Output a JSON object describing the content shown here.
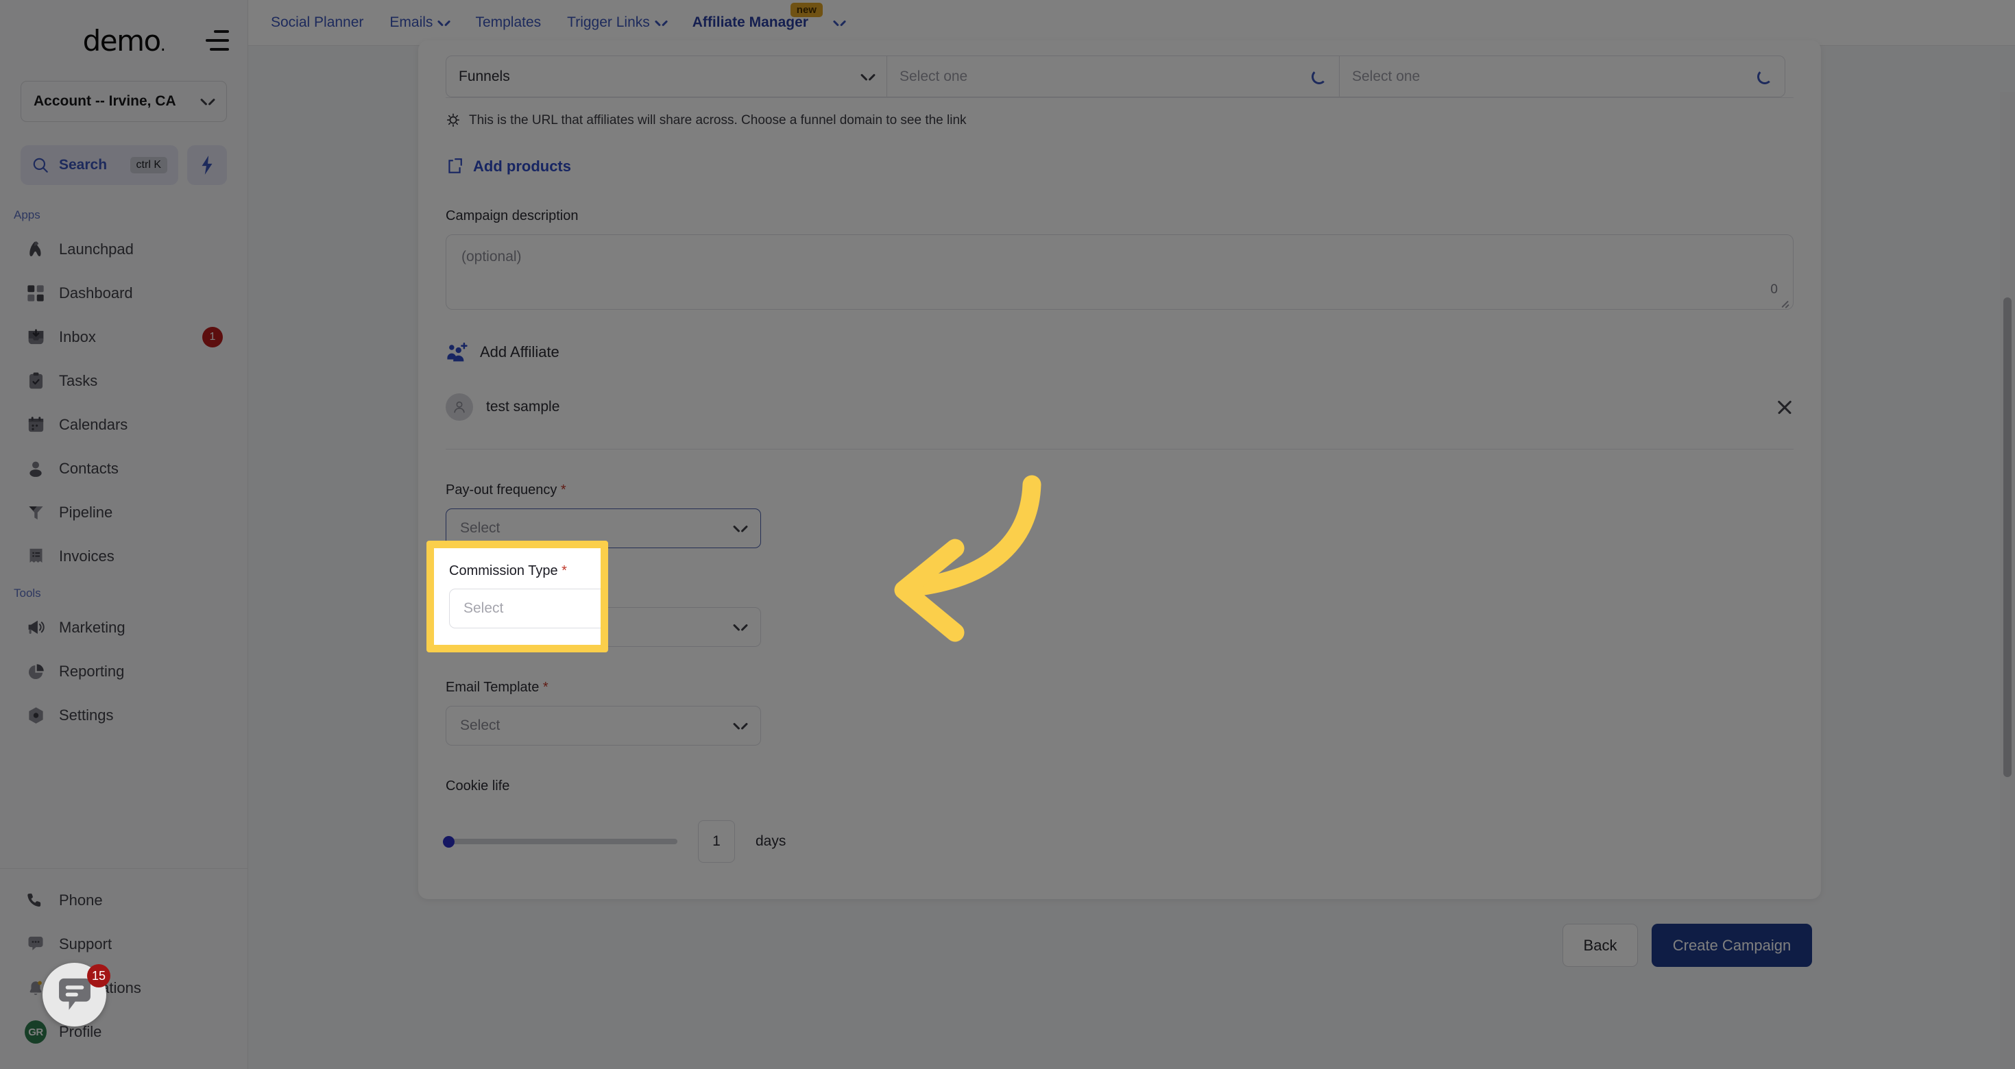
{
  "sidebar": {
    "brand": "demo",
    "account": {
      "label": "Account -- Irvine, CA"
    },
    "search": {
      "label": "Search",
      "shortcut": "ctrl K"
    },
    "groups": [
      {
        "title": "Apps",
        "items": [
          {
            "label": "Launchpad",
            "icon": "launchpad-icon",
            "badge": ""
          },
          {
            "label": "Dashboard",
            "icon": "dashboard-icon",
            "badge": ""
          },
          {
            "label": "Inbox",
            "icon": "inbox-icon",
            "badge": "1"
          },
          {
            "label": "Tasks",
            "icon": "tasks-icon",
            "badge": ""
          },
          {
            "label": "Calendars",
            "icon": "calendar-icon",
            "badge": ""
          },
          {
            "label": "Contacts",
            "icon": "contacts-icon",
            "badge": ""
          },
          {
            "label": "Pipeline",
            "icon": "pipeline-icon",
            "badge": ""
          },
          {
            "label": "Invoices",
            "icon": "invoices-icon",
            "badge": ""
          }
        ]
      },
      {
        "title": "Tools",
        "items": [
          {
            "label": "Marketing",
            "icon": "megaphone-icon",
            "badge": ""
          },
          {
            "label": "Reporting",
            "icon": "pie-chart-icon",
            "badge": ""
          },
          {
            "label": "Settings",
            "icon": "gear-icon",
            "badge": ""
          }
        ]
      }
    ],
    "bottom_items": [
      {
        "label": "Phone",
        "icon": "phone-icon",
        "badge": ""
      },
      {
        "label": "Support",
        "icon": "chat-bubble-icon",
        "badge": ""
      },
      {
        "label": "Notifications",
        "icon": "bell-icon",
        "badge": ""
      },
      {
        "label": "Profile",
        "icon": "avatar-icon",
        "badge": "",
        "avatar_initials": "GR"
      }
    ]
  },
  "topnav": {
    "tabs": [
      {
        "label": "Social Planner",
        "has_chevron": false,
        "active": false,
        "pill": ""
      },
      {
        "label": "Emails",
        "has_chevron": true,
        "active": false,
        "pill": ""
      },
      {
        "label": "Templates",
        "has_chevron": false,
        "active": false,
        "pill": ""
      },
      {
        "label": "Trigger Links",
        "has_chevron": true,
        "active": false,
        "pill": ""
      },
      {
        "label": "Affiliate Manager",
        "has_chevron": true,
        "active": true,
        "pill": "new"
      }
    ]
  },
  "form": {
    "link_builder": {
      "type_value": "Funnels",
      "funnel_placeholder": "Select one",
      "page_placeholder": "Select one"
    },
    "url_hint": "This is the URL that affiliates will share across. Choose a funnel domain to see the link",
    "add_products_label": "Add products",
    "campaign_description": {
      "label": "Campaign description",
      "placeholder": "(optional)",
      "char_count": "0"
    },
    "add_affiliate_label": "Add Affiliate",
    "affiliates": [
      {
        "name": "test sample"
      }
    ],
    "payout_frequency": {
      "label": "Pay-out frequency",
      "required_marker": "*",
      "placeholder": "Select"
    },
    "commission_type": {
      "label": "Commission Type",
      "required_marker": "*",
      "placeholder": "Select"
    },
    "email_template": {
      "label": "Email Template",
      "required_marker": "*",
      "placeholder": "Select"
    },
    "cookie_life": {
      "label": "Cookie life",
      "value": "1",
      "unit": "days"
    }
  },
  "footer": {
    "back_label": "Back",
    "create_label": "Create Campaign"
  },
  "chat_widget": {
    "badge": "15"
  },
  "colors": {
    "highlight_yellow": "#fbcf4b",
    "primary_blue": "#1e3a8a",
    "link_blue": "#2f4bc4",
    "badge_red": "#b91c1c",
    "new_pill": "#e0a526"
  }
}
